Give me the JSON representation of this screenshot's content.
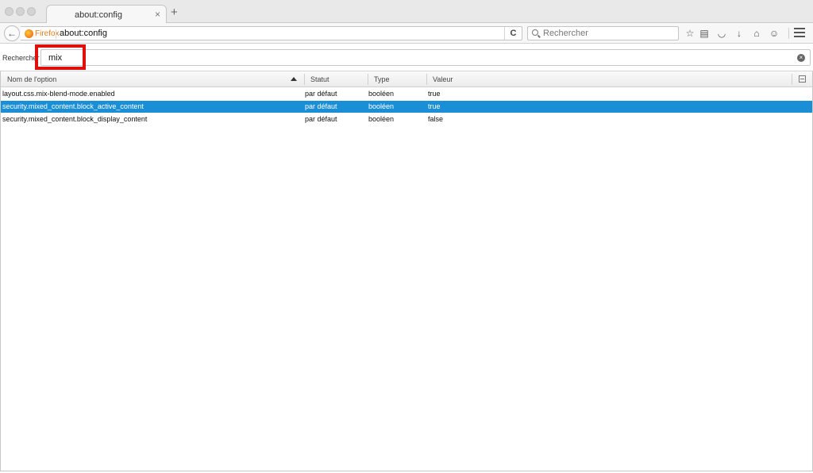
{
  "window": {
    "tab_title": "about:config",
    "tab_close": "×",
    "new_tab": "+"
  },
  "toolbar": {
    "back_glyph": "←",
    "identity_label": "Firefox",
    "url": "about:config",
    "reload_glyph": "C",
    "search_placeholder": "Rechercher",
    "icons": [
      "bookmark-star-icon",
      "reading-list-icon",
      "pocket-icon",
      "download-icon",
      "home-icon",
      "chat-icon",
      "hamburger-menu-icon"
    ],
    "glyphs": {
      "star": "☆",
      "reading_list": "▤",
      "pocket": "◡",
      "download": "↓",
      "home": "⌂",
      "chat": "☺"
    }
  },
  "filter": {
    "label": "Rechercher :",
    "value": "mix",
    "clear_glyph": "×"
  },
  "accent": {
    "selection": "#1a8fd6",
    "highlight_box": "#e10e0e"
  },
  "table": {
    "columns": {
      "name": "Nom de l'option",
      "status": "Statut",
      "type": "Type",
      "value": "Valeur"
    },
    "rows": [
      {
        "name": "layout.css.mix-blend-mode.enabled",
        "status": "par défaut",
        "type": "booléen",
        "value": "true",
        "selected": false
      },
      {
        "name": "security.mixed_content.block_active_content",
        "status": "par défaut",
        "type": "booléen",
        "value": "true",
        "selected": true
      },
      {
        "name": "security.mixed_content.block_display_content",
        "status": "par défaut",
        "type": "booléen",
        "value": "false",
        "selected": false
      }
    ]
  }
}
